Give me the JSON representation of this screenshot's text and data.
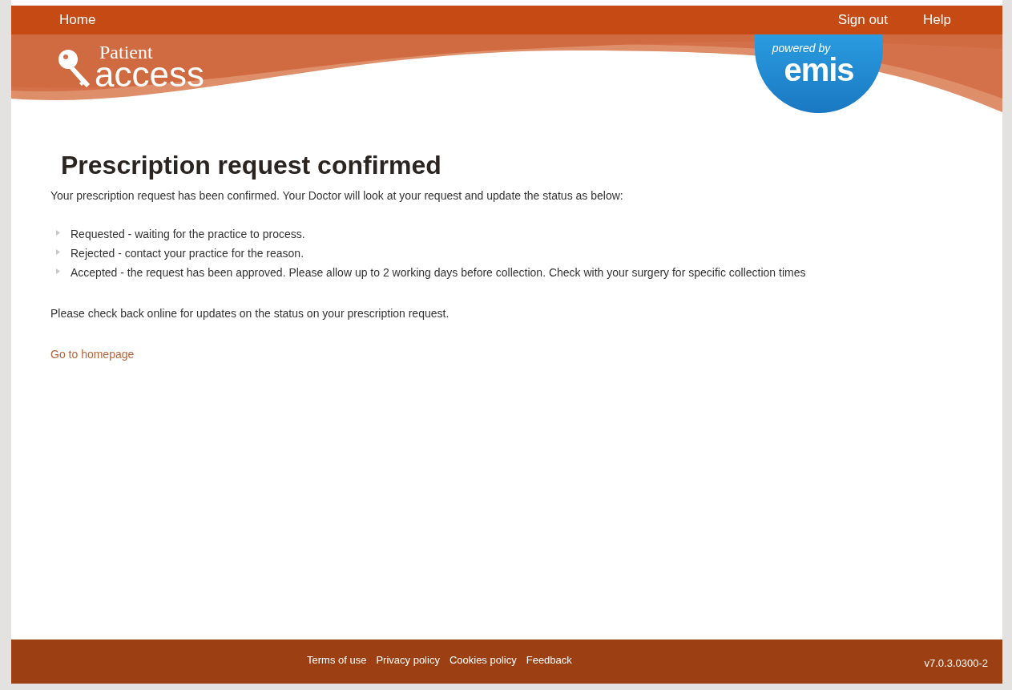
{
  "nav": {
    "left": [
      {
        "label": "Home"
      }
    ],
    "right": [
      {
        "label": "Sign out"
      },
      {
        "label": "Help"
      }
    ]
  },
  "logo": {
    "line1": "Patient",
    "line2": "access"
  },
  "badge": {
    "line1": "powered by",
    "line2": "emis"
  },
  "heading": "Prescription request confirmed",
  "intro": "Your prescription request has been confirmed. Your Doctor will look at your request and update the status as below:",
  "statuses": [
    {
      "text": "Requested - waiting for the practice to process."
    },
    {
      "text": "Rejected - contact your practice for the reason."
    },
    {
      "text": "Accepted - the request has been approved. Please allow up to 2 working days before collection. Check with your surgery for specific collection times"
    }
  ],
  "note": "Please check back online for updates on the status on your prescription request.",
  "link": "Go to homepage",
  "footer": {
    "links": [
      "Terms of use",
      "Privacy policy",
      "Cookies policy",
      "Feedback"
    ],
    "version": "v7.0.3.0300-2"
  }
}
